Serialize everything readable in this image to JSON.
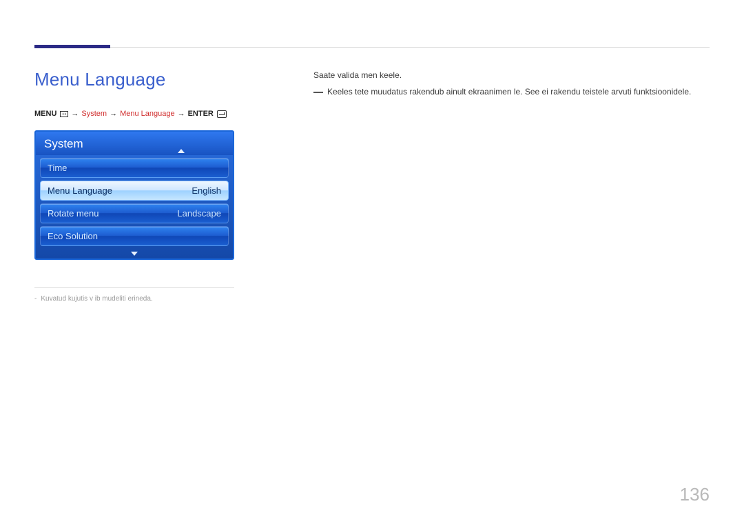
{
  "accent_color": "#2b2a86",
  "title": "Menu Language",
  "breadcrumb": {
    "menu_label": "MENU",
    "arrow": "→",
    "path1": "System",
    "path2": "Menu Language",
    "enter_label": "ENTER"
  },
  "osd": {
    "header": "System",
    "rows": [
      {
        "label": "Time",
        "value": "",
        "selected": false
      },
      {
        "label": "Menu Language",
        "value": "English",
        "selected": true
      },
      {
        "label": "Rotate menu",
        "value": "Landscape",
        "selected": false
      },
      {
        "label": "Eco Solution",
        "value": "",
        "selected": false
      }
    ]
  },
  "footnote": {
    "dash": "-",
    "text": "Kuvatud kujutis v ib mudeliti erineda."
  },
  "description": {
    "line1": "Saate valida men  keele.",
    "note": "Keeles tete muudatus rakendub ainult ekraanimen  le. See ei rakendu teistele arvuti funktsioonidele."
  },
  "page_number": "136"
}
